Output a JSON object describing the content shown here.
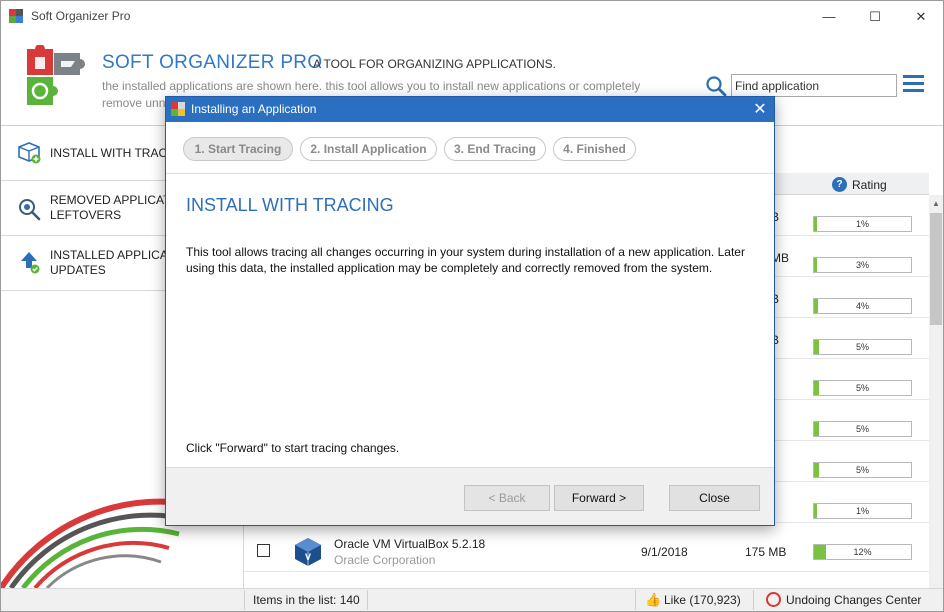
{
  "window": {
    "title": "Soft Organizer Pro",
    "minimize_glyph": "—",
    "maximize_glyph": "☐",
    "close_glyph": "✕"
  },
  "header": {
    "brand": "SOFT ORGANIZER PRO",
    "tagline": "A TOOL FOR ORGANIZING APPLICATIONS.",
    "desc_line1": "the installed applications are shown here. this tool allows you to install new applications or completely",
    "desc_line2": "remove unn",
    "search_placeholder": "Find application"
  },
  "sidebar": {
    "items": [
      {
        "label_line1": "INSTALL WITH TRAC",
        "label_line2": ""
      },
      {
        "label_line1": "REMOVED APPLICATI",
        "label_line2": "LEFTOVERS"
      },
      {
        "label_line1": "INSTALLED APPLICA",
        "label_line2": "UPDATES"
      }
    ]
  },
  "list": {
    "rating_header": "Rating",
    "rows": [
      {
        "size": "B",
        "rating": "1%",
        "rating_value": 1
      },
      {
        "size": "MB",
        "rating": "3%",
        "rating_value": 3
      },
      {
        "size": "B",
        "rating": "4%",
        "rating_value": 4
      },
      {
        "size": "B",
        "rating": "5%",
        "rating_value": 5
      },
      {
        "size": "",
        "rating": "5%",
        "rating_value": 5
      },
      {
        "size": "",
        "rating": "5%",
        "rating_value": 5
      },
      {
        "size": "",
        "rating": "5%",
        "rating_value": 5
      },
      {
        "size": "",
        "rating": "1%",
        "rating_value": 1
      }
    ],
    "vbox": {
      "name": "Oracle VM VirtualBox 5.2.18",
      "publisher": "Oracle Corporation",
      "date": "9/1/2018",
      "size": "175 MB",
      "rating": "12%",
      "rating_value": 12
    }
  },
  "status": {
    "items": "Items in the list: 140",
    "like": "Like (170,923)",
    "undo": "Undoing Changes Center"
  },
  "dialog": {
    "title": "Installing an Application",
    "steps": [
      "1. Start Tracing",
      "2. Install Application",
      "3. End Tracing",
      "4. Finished"
    ],
    "heading": "INSTALL WITH TRACING",
    "body": "This tool allows tracing all changes occurring in your system during installation of a new application. Later using this data, the installed application may be completely and correctly removed from the system.",
    "instruction": "Click \"Forward\" to start tracing changes.",
    "back_label": "< Back",
    "forward_label": "Forward >",
    "close_label": "Close",
    "close_glyph": "✕"
  },
  "colors": {
    "accent": "#2a6fc0",
    "rating_fill": "#7cc242",
    "brand_text": "#2f79c8"
  }
}
